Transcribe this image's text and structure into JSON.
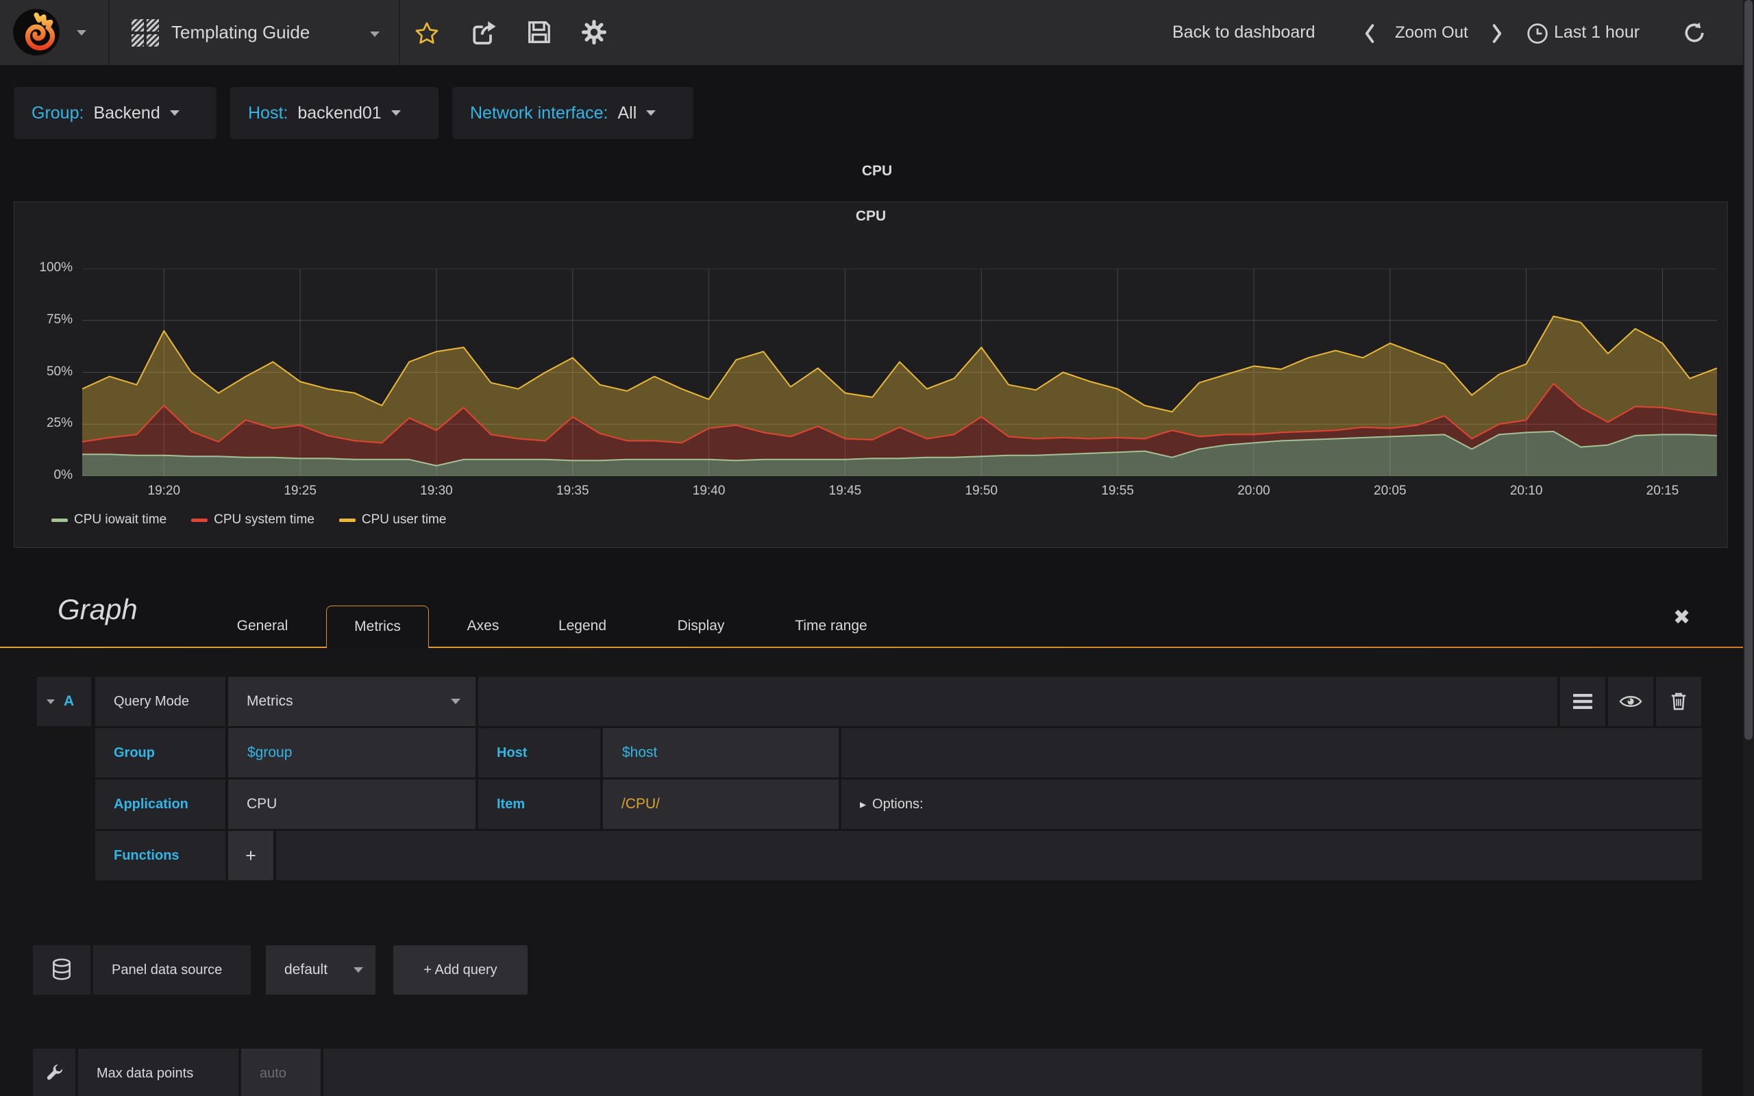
{
  "navbar": {
    "title": "Templating Guide",
    "back_to_dashboard": "Back to dashboard",
    "zoom_out": "Zoom Out",
    "time_range": "Last 1 hour"
  },
  "variables": [
    {
      "label": "Group:",
      "value": "Backend"
    },
    {
      "label": "Host:",
      "value": "backend01"
    },
    {
      "label": "Network interface:",
      "value": "All"
    }
  ],
  "dashboard_row": {
    "title": "CPU"
  },
  "panel": {
    "title": "CPU"
  },
  "chart_data": {
    "type": "area",
    "stacked": true,
    "title": "CPU",
    "unit": "percent",
    "ylim": [
      0,
      100
    ],
    "grid": true,
    "grid_color": "#46464a",
    "legend_position": "bottom",
    "x_start": "19:17",
    "x_end": "20:17",
    "minutes_span": 60,
    "y_ticks": [
      {
        "value": 0,
        "label": "0%"
      },
      {
        "value": 25,
        "label": "25%"
      },
      {
        "value": 50,
        "label": "50%"
      },
      {
        "value": 75,
        "label": "75%"
      },
      {
        "value": 100,
        "label": "100%"
      }
    ],
    "x_ticks": [
      {
        "minute": 3,
        "label": "19:20"
      },
      {
        "minute": 8,
        "label": "19:25"
      },
      {
        "minute": 13,
        "label": "19:30"
      },
      {
        "minute": 18,
        "label": "19:35"
      },
      {
        "minute": 23,
        "label": "19:40"
      },
      {
        "minute": 28,
        "label": "19:45"
      },
      {
        "minute": 33,
        "label": "19:50"
      },
      {
        "minute": 38,
        "label": "19:55"
      },
      {
        "minute": 43,
        "label": "20:00"
      },
      {
        "minute": 48,
        "label": "20:05"
      },
      {
        "minute": 53,
        "label": "20:10"
      },
      {
        "minute": 58,
        "label": "20:15"
      }
    ],
    "series": [
      {
        "name": "CPU iowait time",
        "color": "#A5C295",
        "fill": "rgba(165,194,149,0.45)",
        "values": [
          10.5,
          10.5,
          10,
          10,
          9.5,
          9.5,
          9,
          9,
          8.5,
          8.5,
          8,
          8,
          8,
          5,
          8,
          8,
          8,
          8,
          7.5,
          7.5,
          8,
          8,
          8,
          8,
          7.5,
          8,
          8,
          8,
          8,
          8.5,
          8.5,
          9,
          9,
          9.5,
          10,
          10,
          10.5,
          11,
          11.5,
          12,
          9,
          13,
          15,
          16,
          17,
          17.5,
          18,
          18.5,
          19,
          19.5,
          20,
          13,
          20,
          21,
          21.5,
          14,
          15,
          19.5,
          20,
          20,
          19.5
        ]
      },
      {
        "name": "CPU system time",
        "color": "#E24432",
        "fill": "rgba(226,68,50,0.33)",
        "values": [
          6,
          8,
          10,
          24,
          12,
          7,
          18,
          14,
          16,
          11,
          9,
          8,
          20,
          17,
          25,
          12,
          10,
          9,
          21,
          13,
          9,
          9,
          8,
          15,
          17,
          13,
          11,
          16,
          10,
          9,
          15,
          9,
          11,
          19,
          9,
          8,
          8,
          7,
          7,
          6,
          13,
          6,
          5,
          4,
          4,
          4,
          4,
          5,
          4,
          5,
          9,
          5,
          5,
          6,
          23,
          19,
          11,
          14,
          13,
          11,
          10
        ]
      },
      {
        "name": "CPU user time",
        "color": "#EAB839",
        "fill": "rgba(234,184,57,0.36)",
        "values": [
          25.5,
          29.5,
          24,
          36,
          28.5,
          23.5,
          21,
          32,
          21,
          22.5,
          23,
          18,
          27,
          38,
          29,
          25,
          24,
          33,
          28.5,
          23.5,
          24,
          31,
          26,
          14,
          31.5,
          39,
          24,
          28,
          22,
          20.5,
          31.5,
          24,
          27,
          33.5,
          25,
          23.5,
          31.5,
          27.5,
          23.5,
          16,
          9,
          26,
          29,
          33,
          30.5,
          35.5,
          38.5,
          33.5,
          41,
          34.5,
          25,
          21,
          24,
          27,
          32.5,
          41,
          33,
          37.5,
          31,
          16,
          22.5
        ]
      }
    ]
  },
  "editor": {
    "panel_type": "Graph",
    "tabs": [
      "General",
      "Metrics",
      "Axes",
      "Legend",
      "Display",
      "Time range"
    ],
    "active_tab": "Metrics",
    "close_label": "✖",
    "query": {
      "letter": "A",
      "mode_label": "Query Mode",
      "mode_value": "Metrics",
      "group_label": "Group",
      "group_value": "$group",
      "host_label": "Host",
      "host_value": "$host",
      "app_label": "Application",
      "app_value": "CPU",
      "item_label": "Item",
      "item_value": "/CPU/",
      "options_label": "Options:",
      "functions_label": "Functions",
      "add_function_label": "+"
    },
    "datasource": {
      "label": "Panel data source",
      "value": "default",
      "add_query_label": "+ Add query"
    },
    "options": {
      "max_data_points_label": "Max data points",
      "max_data_points_placeholder": "auto"
    }
  },
  "colors": {
    "accent_cyan": "#33B5E5",
    "accent_orange": "#D98F2B",
    "item_value_color": "#D9A52F"
  }
}
